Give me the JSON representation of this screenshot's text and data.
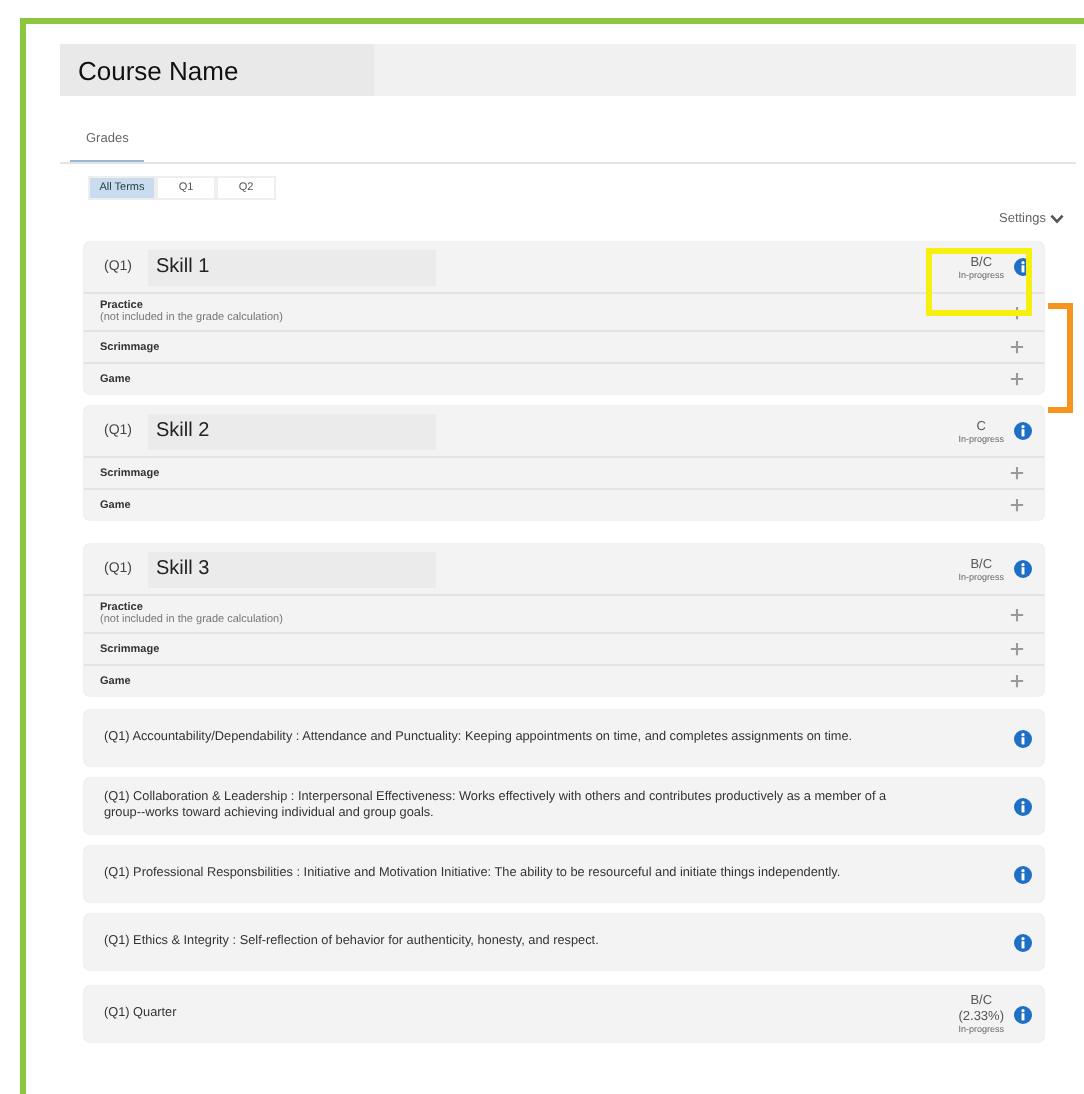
{
  "course": {
    "name": "Course Name"
  },
  "tabs": [
    {
      "label": "Grades",
      "selected": true
    }
  ],
  "terms": [
    {
      "label": "All Terms",
      "selected": true
    },
    {
      "label": "Q1",
      "selected": false
    },
    {
      "label": "Q2",
      "selected": false
    }
  ],
  "settings": {
    "label": "Settings"
  },
  "skills": [
    {
      "term": "(Q1)",
      "name": "Skill 1",
      "grade": "B/C",
      "status": "In-progress",
      "rows": [
        {
          "label": "Practice",
          "note": "(not included in the grade calculation)"
        },
        {
          "label": "Scrimmage"
        },
        {
          "label": "Game"
        }
      ]
    },
    {
      "term": "(Q1)",
      "name": "Skill 2",
      "grade": "C",
      "status": "In-progress",
      "rows": [
        {
          "label": "Scrimmage"
        },
        {
          "label": "Game"
        }
      ]
    },
    {
      "term": "(Q1)",
      "name": "Skill 3",
      "grade": "B/C",
      "status": "In-progress",
      "rows": [
        {
          "label": "Practice",
          "note": "(not included in the grade calculation)"
        },
        {
          "label": "Scrimmage"
        },
        {
          "label": "Game"
        }
      ]
    }
  ],
  "standards": [
    {
      "text": "(Q1) Accountability/Dependability : Attendance and Punctuality: Keeping appointments on time, and completes assignments on time."
    },
    {
      "text": "(Q1) Collaboration & Leadership : Interpersonal Effectiveness: Works effectively with others and contributes productively as a member of a group--works toward achieving individual and group goals."
    },
    {
      "text": "(Q1) Professional Responsbilities : Initiative and Motivation Initiative: The ability to be resourceful and initiate things independently."
    },
    {
      "text": "(Q1) Ethics & Integrity : Self-reflection of behavior for authenticity, honesty, and respect."
    }
  ],
  "quarter": {
    "text": "(Q1) Quarter",
    "grade": "B/C",
    "percent": "(2.33%)",
    "status": "In-progress"
  }
}
